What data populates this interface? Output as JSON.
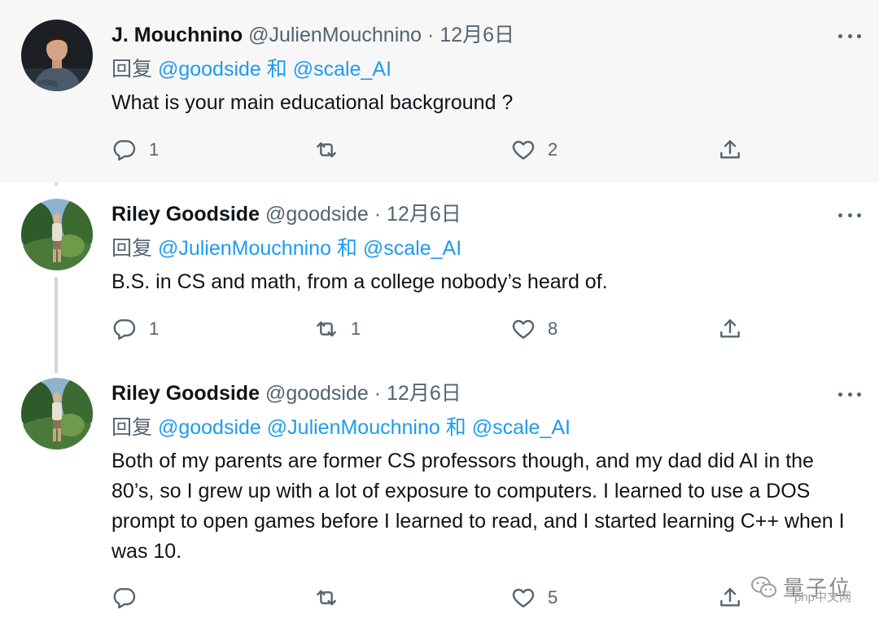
{
  "colors": {
    "link": "#1d9bf0",
    "muted": "#536471",
    "text": "#0f1419",
    "highlight_bg": "#f7f7f7",
    "thread_line": "#cfd9de"
  },
  "icons": {
    "reply": "speech-bubble-icon",
    "retweet": "retweet-icon",
    "like": "heart-icon",
    "share": "share-upload-icon",
    "more": "more-dots-icon"
  },
  "tweets": [
    {
      "name": "J. Mouchnino",
      "handle": "@JulienMouchnino",
      "dot": "·",
      "date": "12月6日",
      "reply_label": "回复",
      "mention_1": "@goodside",
      "and": "和",
      "mention_2": "@scale_AI",
      "text": "What is your main educational background ?",
      "reply_count": "1",
      "retweet_count": "",
      "like_count": "2"
    },
    {
      "name": "Riley Goodside",
      "handle": "@goodside",
      "dot": "·",
      "date": "12月6日",
      "reply_label": "回复",
      "mention_1": "@JulienMouchnino",
      "and": "和",
      "mention_2": "@scale_AI",
      "text": "B.S. in CS and math, from a college nobody’s heard of.",
      "reply_count": "1",
      "retweet_count": "1",
      "like_count": "8"
    },
    {
      "name": "Riley Goodside",
      "handle": "@goodside",
      "dot": "·",
      "date": "12月6日",
      "reply_label": "回复",
      "mention_1": "@goodside",
      "mention_2": "@JulienMouchnino",
      "and": "和",
      "mention_3": "@scale_AI",
      "text": "Both of my parents are former CS professors though, and my dad did AI in the 80’s, so I grew up with a lot of exposure to computers. I learned to use a DOS prompt to open games before I learned to read, and I started learning C++ when I was 10.",
      "reply_count": "",
      "retweet_count": "",
      "like_count": "5"
    }
  ],
  "watermark": {
    "text": "量子位",
    "sub": "php中文网"
  }
}
